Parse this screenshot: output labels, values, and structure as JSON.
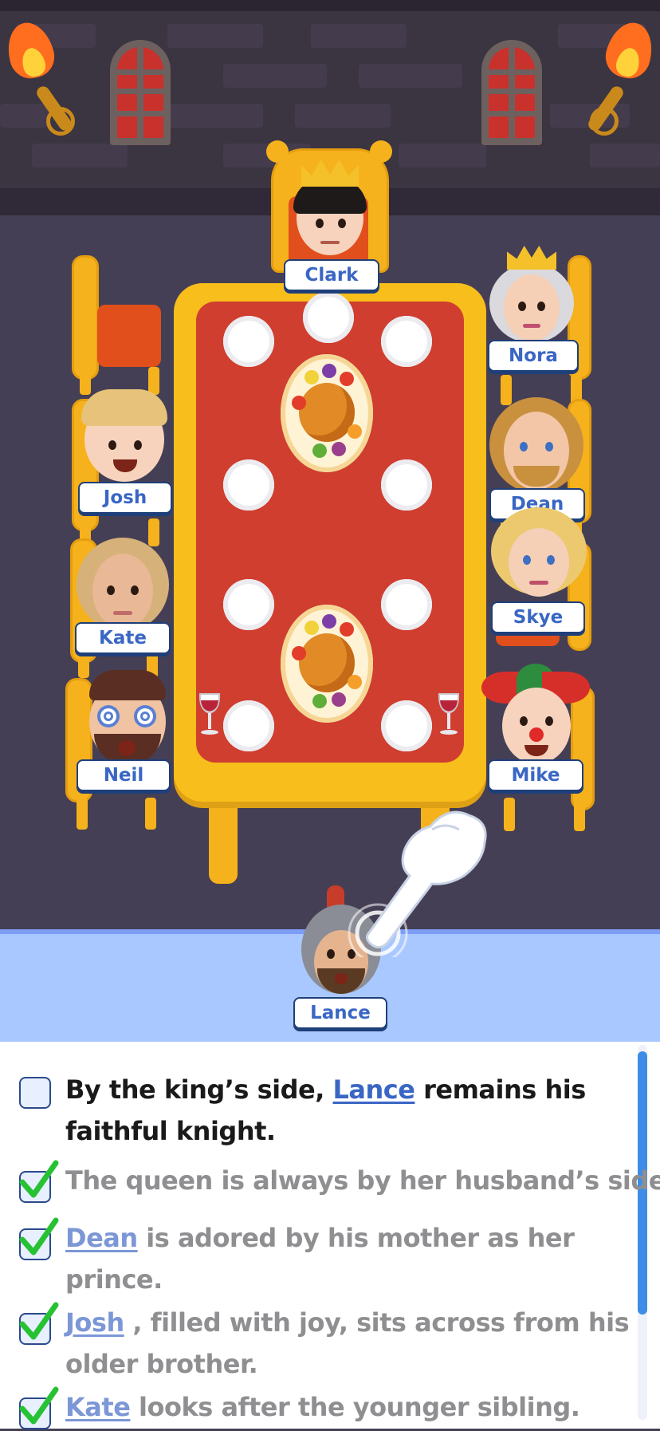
{
  "characters": {
    "clark": "Clark",
    "nora": "Nora",
    "josh": "Josh",
    "dean": "Dean",
    "kate": "Kate",
    "skye": "Skye",
    "neil": "Neil",
    "mike": "Mike",
    "lance": "Lance"
  },
  "clues": [
    {
      "done": false,
      "pre": "By the king’s side, ",
      "link": "Lance",
      "post": " remains his faithful knight."
    },
    {
      "done": true,
      "pre": "The queen is always by her husband’s side.",
      "link": "",
      "post": ""
    },
    {
      "done": true,
      "pre": "",
      "link": "Dean",
      "post": " is adored by his mother as her prince."
    },
    {
      "done": true,
      "pre": "",
      "link": "Josh",
      "post": " , filled with joy, sits across from his older brother."
    },
    {
      "done": true,
      "pre": "",
      "link": "Kate",
      "post": " looks after the younger sibling."
    }
  ],
  "colors": {
    "tablecloth": "#cf3e2f",
    "table": "#f8be1c",
    "bench": "#a9c8ff",
    "name_text": "#3a66c4",
    "check": "#27c234"
  },
  "icons": [
    "torch-icon",
    "window-icon",
    "plate-icon",
    "turkey-platter-icon",
    "wine-glass-icon",
    "pointing-hand-icon",
    "checkmark-icon"
  ]
}
